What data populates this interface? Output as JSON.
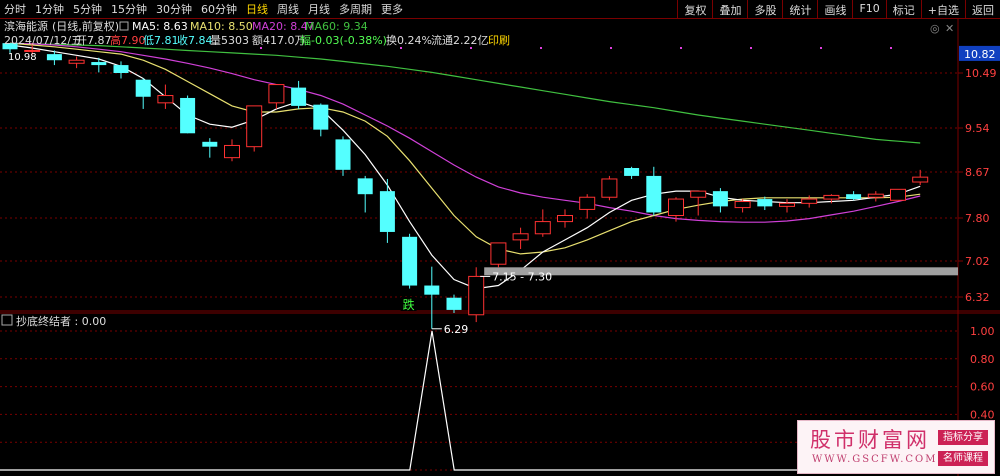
{
  "toolbar": {
    "periods": [
      "分时",
      "1分钟",
      "5分钟",
      "15分钟",
      "30分钟",
      "60分钟",
      "日线",
      "周线",
      "月线",
      "多周期",
      "更多"
    ],
    "active_period": "日线",
    "buttons": [
      "复权",
      "叠加",
      "多股",
      "统计",
      "画线",
      "F10",
      "标记",
      "+自选",
      "返回"
    ]
  },
  "header": {
    "stock_name": "滨海能源",
    "mode": "(日线,前复权)",
    "ma5_label": "MA5: 8.63",
    "ma10_label": "MA10: 8.50",
    "ma20_label": "MA20: 8.47",
    "ma60_label": "MA60: 9.34",
    "date": "2024/07/12/五",
    "open": "开7.87",
    "high": "高7.90",
    "low": "低7.81",
    "close": "收7.84",
    "volume": "量5303",
    "amount": "额417.0万",
    "change": "幅-0.03(-0.38%)",
    "turnover": "换0.24%",
    "float_cap": "流通2.22亿",
    "print": "印刷"
  },
  "colors": {
    "up": "#ff3232",
    "down": "#54ffff",
    "ma5": "#ffffff",
    "ma10": "#e8e070",
    "ma20": "#d040d8",
    "ma60": "#40c040",
    "grid": "#7a0000",
    "band": "#a0a0a0"
  },
  "indicator": {
    "title": "抄底终结者 : 0.00",
    "signal_text": "跌"
  },
  "watermark": {
    "site": "股市财富网",
    "url": "WWW.GSCFW.COM",
    "badge1": "指标分享",
    "badge2": "名师课程"
  },
  "chart_data": [
    {
      "type": "candlestick",
      "y_ticks": [
        "10.49",
        "9.54",
        "8.67",
        "7.80",
        "7.02",
        "6.32"
      ],
      "last_price_label": "10.82",
      "left_top_label": "10.98",
      "annotations": {
        "low_label": "6.29",
        "range_label": "7.15 - 7.30"
      },
      "candles": [
        {
          "open": 10.98,
          "high": 10.98,
          "low": 10.82,
          "close": 10.88
        },
        {
          "open": 10.86,
          "high": 10.98,
          "low": 10.79,
          "close": 10.86
        },
        {
          "open": 10.8,
          "high": 10.86,
          "low": 10.62,
          "close": 10.7
        },
        {
          "open": 10.65,
          "high": 10.76,
          "low": 10.57,
          "close": 10.7
        },
        {
          "open": 10.67,
          "high": 10.74,
          "low": 10.5,
          "close": 10.62
        },
        {
          "open": 10.62,
          "high": 10.68,
          "low": 10.4,
          "close": 10.49
        },
        {
          "open": 10.38,
          "high": 10.4,
          "low": 9.9,
          "close": 10.1
        },
        {
          "open": 10.0,
          "high": 10.3,
          "low": 9.9,
          "close": 10.12
        },
        {
          "open": 10.08,
          "high": 10.12,
          "low": 9.5,
          "close": 9.5
        },
        {
          "open": 9.36,
          "high": 9.42,
          "low": 9.1,
          "close": 9.28
        },
        {
          "open": 9.1,
          "high": 9.4,
          "low": 9.04,
          "close": 9.3
        },
        {
          "open": 9.28,
          "high": 9.95,
          "low": 9.2,
          "close": 9.95
        },
        {
          "open": 10.0,
          "high": 10.3,
          "low": 9.9,
          "close": 10.3
        },
        {
          "open": 10.25,
          "high": 10.36,
          "low": 9.9,
          "close": 9.95
        },
        {
          "open": 9.97,
          "high": 9.99,
          "low": 9.45,
          "close": 9.56
        },
        {
          "open": 9.4,
          "high": 9.45,
          "low": 8.8,
          "close": 8.9
        },
        {
          "open": 8.76,
          "high": 8.8,
          "low": 8.2,
          "close": 8.5
        },
        {
          "open": 8.55,
          "high": 8.75,
          "low": 7.7,
          "close": 7.88
        },
        {
          "open": 7.8,
          "high": 7.85,
          "low": 6.95,
          "close": 7.0
        },
        {
          "open": 7.0,
          "high": 7.31,
          "low": 6.29,
          "close": 6.85
        },
        {
          "open": 6.8,
          "high": 6.85,
          "low": 6.55,
          "close": 6.6
        },
        {
          "open": 6.52,
          "high": 7.3,
          "low": 6.4,
          "close": 7.15
        },
        {
          "open": 7.35,
          "high": 7.7,
          "low": 7.3,
          "close": 7.7
        },
        {
          "open": 7.75,
          "high": 7.95,
          "low": 7.6,
          "close": 7.85
        },
        {
          "open": 7.85,
          "high": 8.25,
          "low": 7.8,
          "close": 8.05
        },
        {
          "open": 8.05,
          "high": 8.25,
          "low": 7.95,
          "close": 8.15
        },
        {
          "open": 8.25,
          "high": 8.5,
          "low": 8.1,
          "close": 8.45
        },
        {
          "open": 8.45,
          "high": 8.8,
          "low": 8.4,
          "close": 8.75
        },
        {
          "open": 8.93,
          "high": 8.95,
          "low": 8.75,
          "close": 8.8
        },
        {
          "open": 8.8,
          "high": 8.95,
          "low": 8.15,
          "close": 8.2
        },
        {
          "open": 8.15,
          "high": 8.45,
          "low": 8.05,
          "close": 8.42
        },
        {
          "open": 8.45,
          "high": 8.55,
          "low": 8.15,
          "close": 8.55
        },
        {
          "open": 8.55,
          "high": 8.6,
          "low": 8.2,
          "close": 8.3
        },
        {
          "open": 8.28,
          "high": 8.42,
          "low": 8.2,
          "close": 8.38
        },
        {
          "open": 8.42,
          "high": 8.46,
          "low": 8.24,
          "close": 8.3
        },
        {
          "open": 8.3,
          "high": 8.42,
          "low": 8.2,
          "close": 8.35
        },
        {
          "open": 8.35,
          "high": 8.48,
          "low": 8.28,
          "close": 8.42
        },
        {
          "open": 8.42,
          "high": 8.5,
          "low": 8.35,
          "close": 8.48
        },
        {
          "open": 8.5,
          "high": 8.55,
          "low": 8.4,
          "close": 8.42
        },
        {
          "open": 8.45,
          "high": 8.55,
          "low": 8.38,
          "close": 8.5
        },
        {
          "open": 8.4,
          "high": 8.58,
          "low": 8.4,
          "close": 8.58
        },
        {
          "open": 8.7,
          "high": 8.9,
          "low": 8.65,
          "close": 8.78
        }
      ],
      "ma5": [
        10.95,
        10.9,
        10.84,
        10.78,
        10.72,
        10.6,
        10.4,
        10.1,
        9.8,
        9.65,
        9.6,
        9.72,
        9.9,
        10.02,
        9.9,
        9.55,
        9.15,
        8.65,
        8.05,
        7.5,
        7.1,
        6.95,
        7.0,
        7.25,
        7.55,
        7.75,
        7.95,
        8.2,
        8.4,
        8.5,
        8.55,
        8.55,
        8.45,
        8.4,
        8.38,
        8.36,
        8.36,
        8.38,
        8.4,
        8.45,
        8.5,
        8.63
      ],
      "ma10": [
        10.98,
        10.95,
        10.92,
        10.88,
        10.84,
        10.8,
        10.7,
        10.55,
        10.35,
        10.15,
        9.95,
        9.85,
        9.85,
        9.9,
        9.92,
        9.85,
        9.7,
        9.45,
        9.05,
        8.6,
        8.15,
        7.8,
        7.6,
        7.52,
        7.55,
        7.62,
        7.75,
        7.9,
        8.05,
        8.15,
        8.25,
        8.32,
        8.38,
        8.42,
        8.44,
        8.44,
        8.44,
        8.44,
        8.44,
        8.44,
        8.45,
        8.5
      ],
      "ma20": [
        10.98,
        10.97,
        10.95,
        10.92,
        10.88,
        10.84,
        10.78,
        10.72,
        10.65,
        10.57,
        10.48,
        10.38,
        10.3,
        10.22,
        10.12,
        9.98,
        9.8,
        9.62,
        9.42,
        9.2,
        8.98,
        8.78,
        8.62,
        8.52,
        8.45,
        8.4,
        8.35,
        8.28,
        8.22,
        8.15,
        8.1,
        8.07,
        8.05,
        8.04,
        8.04,
        8.06,
        8.1,
        8.16,
        8.22,
        8.3,
        8.38,
        8.47
      ],
      "ma60": [
        10.98,
        10.97,
        10.96,
        10.95,
        10.94,
        10.92,
        10.9,
        10.88,
        10.86,
        10.84,
        10.82,
        10.8,
        10.78,
        10.75,
        10.72,
        10.68,
        10.64,
        10.6,
        10.55,
        10.5,
        10.44,
        10.38,
        10.32,
        10.26,
        10.2,
        10.14,
        10.08,
        10.02,
        9.97,
        9.92,
        9.86,
        9.8,
        9.75,
        9.7,
        9.65,
        9.6,
        9.55,
        9.5,
        9.45,
        9.4,
        9.37,
        9.34
      ]
    },
    {
      "type": "line",
      "name": "抄底终结者",
      "y_ticks": [
        "1.00",
        "0.80",
        "0.60",
        "0.40",
        "0.20",
        "0.00"
      ],
      "ylim": [
        0,
        1
      ],
      "values": [
        0,
        0,
        0,
        0,
        0,
        0,
        0,
        0,
        0,
        0,
        0,
        0,
        0,
        0,
        0,
        0,
        0,
        0,
        0,
        1,
        0,
        0,
        0,
        0,
        0,
        0,
        0,
        0,
        0,
        0,
        0,
        0,
        0,
        0,
        0,
        0,
        0,
        0,
        0,
        0,
        0,
        0
      ]
    }
  ]
}
